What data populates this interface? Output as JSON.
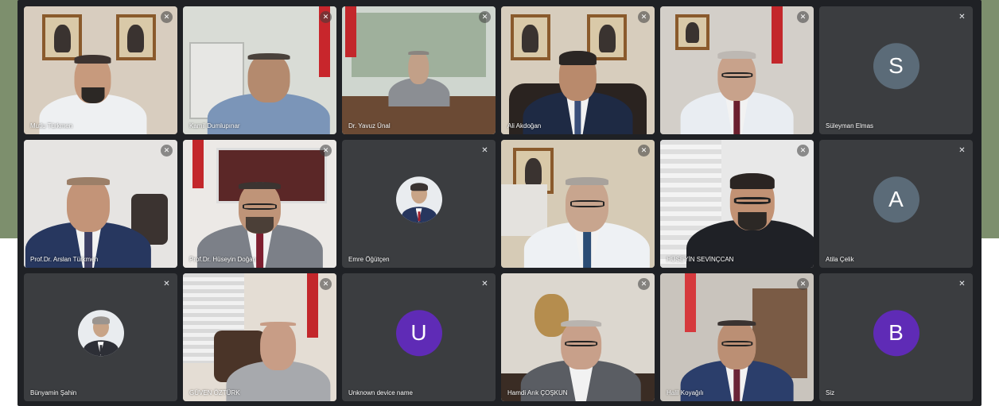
{
  "colors": {
    "background_band": "#7d8f6d",
    "meeting_background": "#1f2125",
    "audio_tile": "#3b3d40",
    "avatar_slate": "#5b6b78",
    "avatar_purple": "#5f2bb6"
  },
  "icons": {
    "mute": "mic-off-icon"
  },
  "tiles": [
    {
      "name": "Mutlu Türkmen",
      "kind": "video"
    },
    {
      "name": "Kamil Dumlupınar",
      "kind": "video"
    },
    {
      "name": "Dr. Yavuz Ünal",
      "kind": "video"
    },
    {
      "name": "Ali Akdoğan",
      "kind": "video"
    },
    {
      "name": "",
      "kind": "video"
    },
    {
      "name": "Süleyman Elmas",
      "kind": "avatar",
      "initial": "S",
      "avatar_color": "#5b6b78"
    },
    {
      "name": "Prof.Dr. Arslan Türkmen",
      "kind": "video"
    },
    {
      "name": "Prof.Dr. Hüseyin Doğan",
      "kind": "video"
    },
    {
      "name": "Emre Öğütçen",
      "kind": "avatar-photo"
    },
    {
      "name": "",
      "kind": "video"
    },
    {
      "name": "HÜSEYİN SEVİNÇCAN",
      "kind": "video"
    },
    {
      "name": "Atila Çelik",
      "kind": "avatar",
      "initial": "A",
      "avatar_color": "#5b6b78"
    },
    {
      "name": "Bünyamin Şahin",
      "kind": "avatar-photo"
    },
    {
      "name": "GÜVEN ÖZTÜRK",
      "kind": "video"
    },
    {
      "name": "Unknown device name",
      "kind": "avatar",
      "initial": "U",
      "avatar_color": "#5f2bb6"
    },
    {
      "name": "Hamdi Arık ÇOŞKUN",
      "kind": "video"
    },
    {
      "name": "Halil Koyağılı",
      "kind": "video"
    },
    {
      "name": "Siz",
      "kind": "avatar",
      "initial": "B",
      "avatar_color": "#5f2bb6"
    }
  ]
}
